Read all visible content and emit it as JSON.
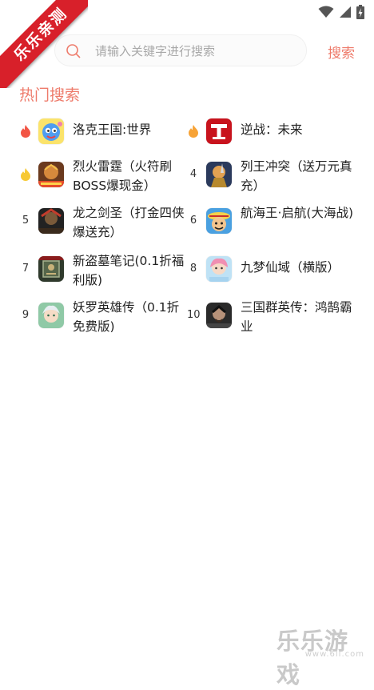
{
  "ribbon": {
    "text": "乐乐亲测"
  },
  "search": {
    "placeholder": "请输入关键字进行搜索",
    "value": "",
    "button_label": "搜索"
  },
  "hot_section": {
    "title": "热门搜索",
    "items": [
      {
        "rank": "1",
        "badge": "flame-red",
        "name": "洛克王国:世界",
        "icon": "roco-kingdom-game-icon"
      },
      {
        "rank": "2",
        "badge": "flame-orange",
        "name": "逆战：未来",
        "icon": "nizhan-future-game-icon"
      },
      {
        "rank": "3",
        "badge": "flame-yellow",
        "name": "烈火雷霆（火符刷BOSS爆现金）",
        "icon": "liehuo-leiting-game-icon"
      },
      {
        "rank": "4",
        "badge": "",
        "name": "列王冲突（送万元真充）",
        "icon": "liewang-chongtu-game-icon"
      },
      {
        "rank": "5",
        "badge": "",
        "name": "龙之剑圣（打金四侠爆送充）",
        "icon": "longzhi-jiansheng-game-icon"
      },
      {
        "rank": "6",
        "badge": "",
        "name": "航海王·启航(大海战)",
        "icon": "hanghaiwang-game-icon"
      },
      {
        "rank": "7",
        "badge": "",
        "name": "新盗墓笔记(0.1折福利版)",
        "icon": "daomu-biji-game-icon"
      },
      {
        "rank": "8",
        "badge": "",
        "name": "九梦仙域（横版）",
        "icon": "jiumeng-xianyu-game-icon"
      },
      {
        "rank": "9",
        "badge": "",
        "name": "妖罗英雄传（0.1折免费版)",
        "icon": "yaoluo-yingxiong-game-icon"
      },
      {
        "rank": "10",
        "badge": "",
        "name": "三国群英传：鸿鹄霸业",
        "icon": "sanguo-qunying-game-icon"
      }
    ]
  },
  "watermark": {
    "text": "乐乐游戏",
    "url": "www.6ll.com"
  },
  "colors": {
    "accent": "#ee7b6b",
    "ribbon": "#d8202a"
  }
}
